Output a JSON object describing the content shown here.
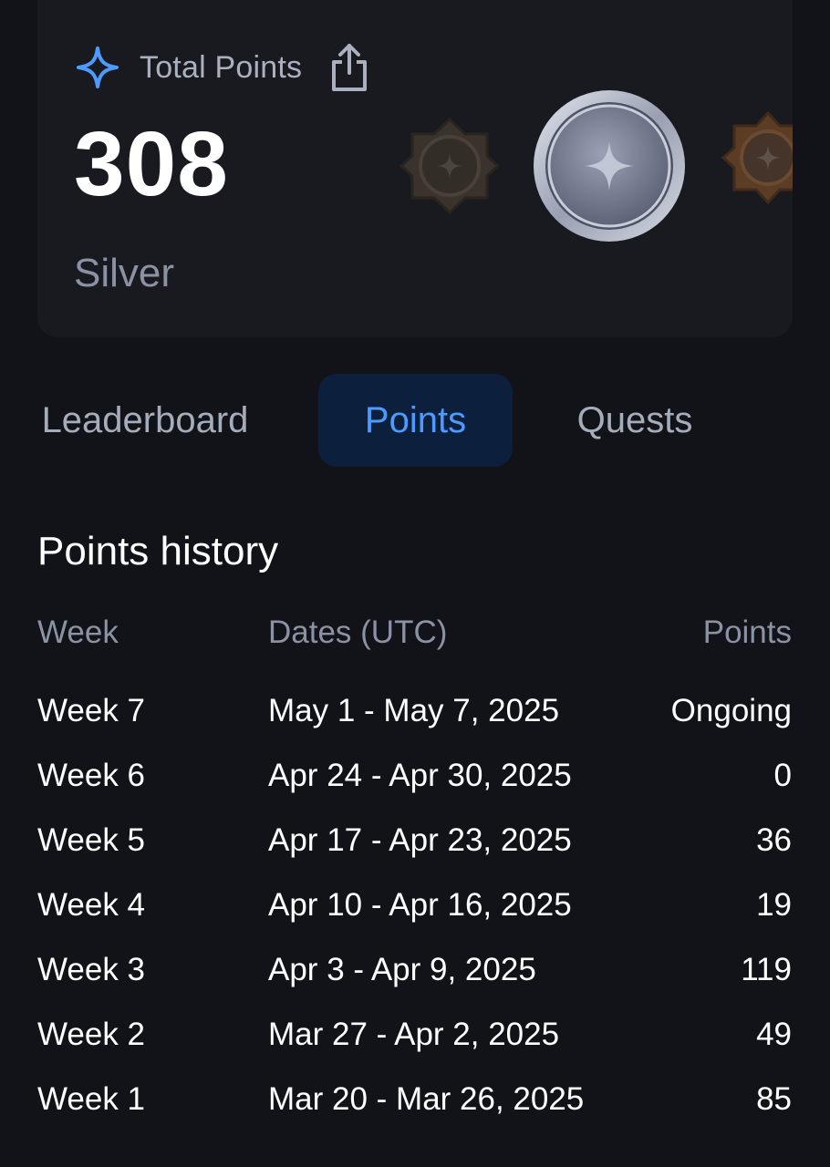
{
  "summary": {
    "label": "Total Points",
    "value": "308",
    "tier": "Silver",
    "icons": {
      "label_icon": "sparkle-icon",
      "share": "share-icon",
      "badges": [
        "bronze-badge-icon",
        "silver-badge-icon",
        "gold-badge-icon"
      ]
    }
  },
  "tabs": [
    {
      "label": "Leaderboard",
      "active": false
    },
    {
      "label": "Points",
      "active": true
    },
    {
      "label": "Quests",
      "active": false
    }
  ],
  "history": {
    "title": "Points history",
    "columns": {
      "week": "Week",
      "dates": "Dates (UTC)",
      "points": "Points"
    },
    "rows": [
      {
        "week": "Week 7",
        "dates": "May 1 - May 7, 2025",
        "points": "Ongoing"
      },
      {
        "week": "Week 6",
        "dates": "Apr 24 - Apr 30, 2025",
        "points": "0"
      },
      {
        "week": "Week 5",
        "dates": "Apr 17 - Apr 23, 2025",
        "points": "36"
      },
      {
        "week": "Week 4",
        "dates": "Apr 10 - Apr 16, 2025",
        "points": "19"
      },
      {
        "week": "Week 3",
        "dates": "Apr 3 - Apr 9, 2025",
        "points": "119"
      },
      {
        "week": "Week 2",
        "dates": "Mar 27 - Apr 2, 2025",
        "points": "49"
      },
      {
        "week": "Week 1",
        "dates": "Mar 20 - Mar 26, 2025",
        "points": "85"
      }
    ]
  },
  "colors": {
    "background": "#111318",
    "card": "#181a20",
    "accent": "#4d9bff",
    "active_tab_bg": "#0c1f3d",
    "muted_text": "#8a92a3"
  }
}
